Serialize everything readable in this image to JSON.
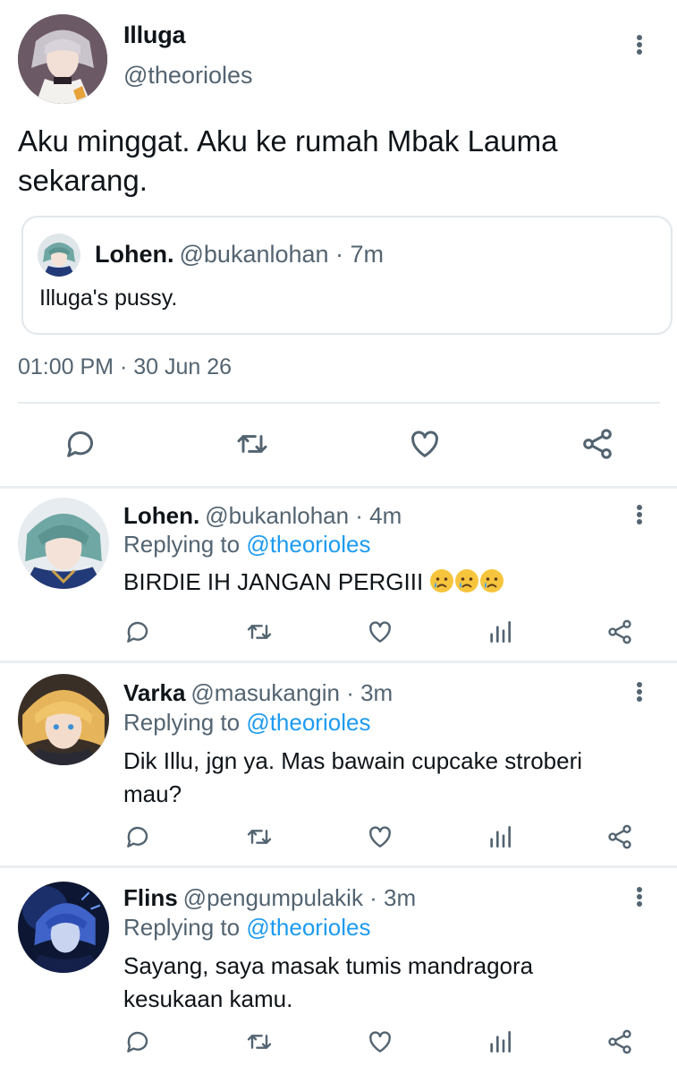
{
  "main_tweet": {
    "author_name": "Illuga",
    "author_handle": "@theorioles",
    "text": "Aku minggat. Aku ke rumah Mbak Lauma sekarang.",
    "quote": {
      "author_name": "Lohen.",
      "author_handle": "@bukanlohan · 7m",
      "text": "Illuga's pussy."
    },
    "timestamp": "01:00 PM · 30 Jun 26"
  },
  "replies": [
    {
      "author_name": "Lohen.",
      "author_handle": "@bukanlohan · 4m",
      "replying_prefix": "Replying to ",
      "replying_to": "@theorioles",
      "text": "BIRDIE IH JANGAN PERGIII",
      "emoji": [
        "crying-face",
        "crying-face",
        "crying-face"
      ]
    },
    {
      "author_name": "Varka",
      "author_handle": "@masukangin · 3m",
      "replying_prefix": "Replying to ",
      "replying_to": "@theorioles",
      "text": "Dik Illu, jgn ya. Mas bawain cupcake stroberi mau?"
    },
    {
      "author_name": "Flins",
      "author_handle": "@pengumpulakik · 3m",
      "replying_prefix": "Replying to ",
      "replying_to": "@theorioles",
      "text": "Sayang, saya masak tumis mandragora kesukaan kamu."
    }
  ],
  "colors": {
    "text": "#0f1419",
    "secondary": "#536471",
    "link": "#1d9bf0",
    "divider": "#e6ebee"
  },
  "icons": [
    "reply-icon",
    "retweet-icon",
    "like-icon",
    "share-icon",
    "analytics-icon",
    "more-options-icon"
  ]
}
